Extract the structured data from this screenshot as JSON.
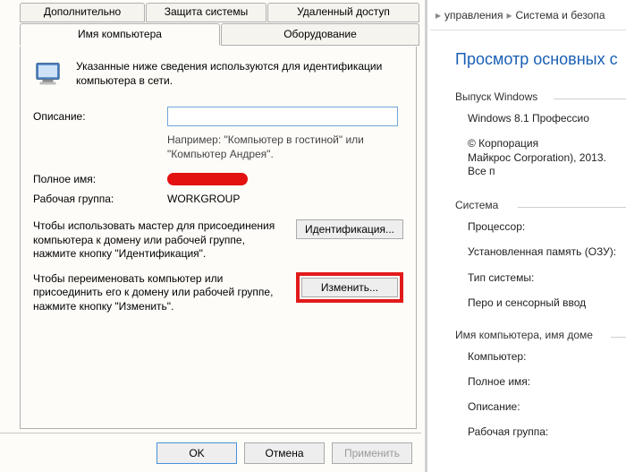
{
  "dialog": {
    "tabs": {
      "extra": "Дополнительно",
      "protect": "Защита системы",
      "remote": "Удаленный доступ",
      "name": "Имя компьютера",
      "hw": "Оборудование"
    },
    "intro": "Указанные ниже сведения используются для идентификации компьютера в сети.",
    "desc_label": "Описание:",
    "desc_value": "",
    "desc_hint": "Например: \"Компьютер в гостиной\" или \"Компьютер Андрея\".",
    "fullname_label": "Полное имя:",
    "workgroup_label": "Рабочая группа:",
    "workgroup_value": "WORKGROUP",
    "help_id_text": "Чтобы использовать мастер для присоединения компьютера к домену или рабочей группе, нажмите кнопку \"Идентификация\".",
    "btn_identify": "Идентификация...",
    "help_change_text": "Чтобы переименовать компьютер или присоединить его к домену или рабочей группе, нажмите кнопку \"Изменить\".",
    "btn_change": "Изменить...",
    "footer": {
      "ok": "OK",
      "cancel": "Отмена",
      "apply": "Применить"
    }
  },
  "right": {
    "crumb1": "управления",
    "crumb2": "Система и безопа",
    "heading": "Просмотр основных с",
    "group_edition": "Выпуск Windows",
    "edition_name": "Windows 8.1 Профессио",
    "edition_copy": "© Корпорация Майкрос Corporation), 2013. Все п",
    "group_system": "Система",
    "sys_cpu": "Процессор:",
    "sys_ram": "Установленная память (ОЗУ):",
    "sys_type": "Тип системы:",
    "sys_touch": "Перо и сенсорный ввод",
    "group_names": "Имя компьютера, имя доме",
    "name_computer": "Компьютер:",
    "name_full": "Полное имя:",
    "name_desc": "Описание:",
    "name_wg": "Рабочая группа:"
  }
}
